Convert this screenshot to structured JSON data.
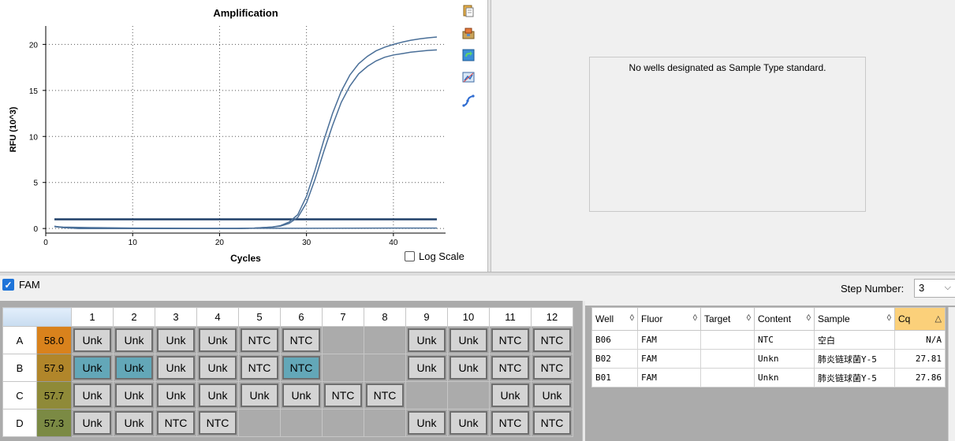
{
  "chart_data": {
    "type": "line",
    "title": "Amplification",
    "xlabel": "Cycles",
    "ylabel": "RFU (10^3)",
    "xlim": [
      0,
      46
    ],
    "ylim": [
      -0.5,
      22
    ],
    "xticks": [
      0,
      10,
      20,
      30,
      40
    ],
    "yticks": [
      0,
      5,
      10,
      15,
      20
    ],
    "grid": true,
    "threshold": 1.0,
    "series": [
      {
        "x": [
          1,
          2,
          4,
          6,
          8,
          10,
          12,
          14,
          16,
          18,
          20,
          22,
          24,
          25,
          26,
          27,
          28,
          29,
          30,
          31,
          32,
          33,
          34,
          35,
          36,
          37,
          38,
          39,
          40,
          41,
          42,
          43,
          44,
          45
        ],
        "y": [
          0.2,
          0.1,
          0,
          0,
          0,
          0,
          0,
          0,
          0,
          0,
          0,
          0,
          0.05,
          0.1,
          0.15,
          0.3,
          0.7,
          1.5,
          3.5,
          6.4,
          9.6,
          12.5,
          14.9,
          16.7,
          17.9,
          18.7,
          19.3,
          19.7,
          20,
          20.25,
          20.45,
          20.6,
          20.72,
          20.8
        ]
      },
      {
        "x": [
          1,
          2,
          4,
          6,
          8,
          10,
          12,
          14,
          16,
          18,
          20,
          22,
          24,
          25,
          26,
          27,
          28,
          29,
          30,
          31,
          32,
          33,
          34,
          35,
          36,
          37,
          38,
          39,
          40,
          41,
          42,
          43,
          44,
          45
        ],
        "y": [
          0.25,
          0.1,
          0,
          0,
          0,
          0,
          0,
          0,
          0,
          0,
          0,
          0,
          0.05,
          0.1,
          0.15,
          0.25,
          0.55,
          1.2,
          2.8,
          5.4,
          8.4,
          11.2,
          13.7,
          15.5,
          16.8,
          17.6,
          18.2,
          18.6,
          18.85,
          19.0,
          19.15,
          19.25,
          19.35,
          19.4
        ]
      },
      {
        "x": [
          1,
          2,
          5,
          10,
          20,
          30,
          40,
          45
        ],
        "y": [
          0.2,
          0.15,
          0.1,
          0.05,
          0.02,
          0.02,
          0.05,
          0.05
        ]
      }
    ]
  },
  "colors": {
    "curve": "#4a6f98",
    "threshold": "#1f3f68",
    "temp_low": "#7b8a44",
    "temp_high": "#d9821c",
    "selected_well": "#63a7b8"
  },
  "toolbar_icons": [
    "copy-icon",
    "export-icon",
    "refresh-icon",
    "image-icon",
    "curve-icon"
  ],
  "log_scale_label": "Log Scale",
  "standard_message": "No wells designated as Sample Type standard.",
  "fluor_filter": {
    "label": "FAM",
    "checked": true
  },
  "step": {
    "label": "Step Number:",
    "value": "3"
  },
  "plate": {
    "columns": [
      "1",
      "2",
      "3",
      "4",
      "5",
      "6",
      "7",
      "8",
      "9",
      "10",
      "11",
      "12"
    ],
    "rows": [
      {
        "label": "A",
        "temp": "58.0",
        "tempColor": "#d9821c",
        "wells": [
          "Unk",
          "Unk",
          "Unk",
          "Unk",
          "NTC",
          "NTC",
          "",
          "",
          "Unk",
          "Unk",
          "NTC",
          "NTC"
        ],
        "selected": []
      },
      {
        "label": "B",
        "temp": "57.9",
        "tempColor": "#b1862a",
        "wells": [
          "Unk",
          "Unk",
          "Unk",
          "Unk",
          "NTC",
          "NTC",
          "",
          "",
          "Unk",
          "Unk",
          "NTC",
          "NTC"
        ],
        "selected": [
          0,
          1,
          5
        ]
      },
      {
        "label": "C",
        "temp": "57.7",
        "tempColor": "#8f8a38",
        "wells": [
          "Unk",
          "Unk",
          "Unk",
          "Unk",
          "Unk",
          "Unk",
          "NTC",
          "NTC",
          "",
          "",
          "Unk",
          "Unk"
        ],
        "selected": []
      },
      {
        "label": "D",
        "temp": "57.3",
        "tempColor": "#7b8a44",
        "wells": [
          "Unk",
          "Unk",
          "NTC",
          "NTC",
          "",
          "",
          "",
          "",
          "Unk",
          "Unk",
          "NTC",
          "NTC"
        ],
        "selected": []
      }
    ]
  },
  "results": {
    "headers": [
      "Well",
      "Fluor",
      "Target",
      "Content",
      "Sample",
      "Cq"
    ],
    "rows": [
      [
        "B06",
        "FAM",
        "",
        "NTC",
        "空白",
        "N/A"
      ],
      [
        "B02",
        "FAM",
        "",
        "Unkn",
        "肺炎链球菌Y-5",
        "27.81"
      ],
      [
        "B01",
        "FAM",
        "",
        "Unkn",
        "肺炎链球菌Y-5",
        "27.86"
      ]
    ]
  }
}
